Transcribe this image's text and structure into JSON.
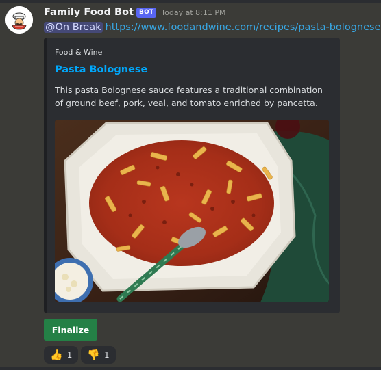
{
  "message": {
    "username": "Family Food Bot",
    "bot_tag": "BOT",
    "timestamp": "Today at 8:11 PM",
    "mention": "@On Break",
    "link": "https://www.foodandwine.com/recipes/pasta-bolognese",
    "avatar_icon": "chef-avatar-icon"
  },
  "embed": {
    "provider": "Food & Wine",
    "title": "Pasta Bolognese",
    "description": "This pasta Bolognese sauce features a traditional combination of ground beef, pork, veal, and tomato enriched by pancetta.",
    "image_alt": "pasta-bolognese-photo"
  },
  "actions": {
    "finalize_label": "Finalize"
  },
  "reactions": [
    {
      "emoji": "👍",
      "icon": "thumbs-up-icon",
      "count": "1"
    },
    {
      "emoji": "👎",
      "icon": "thumbs-down-icon",
      "count": "1"
    }
  ],
  "colors": {
    "background": "#3b3b37",
    "embed_bg": "#2b2d31",
    "link": "#38a7e3",
    "embed_title": "#00a8fc",
    "bot_tag": "#5865f2",
    "button_green": "#248046"
  }
}
